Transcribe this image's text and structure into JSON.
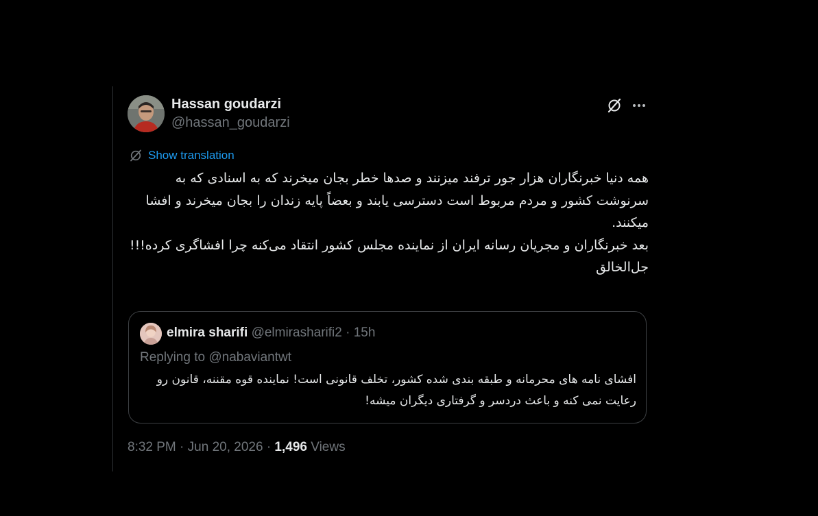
{
  "author": {
    "display_name": "Hassan goudarzi",
    "handle": "@hassan_goudarzi"
  },
  "actions": {
    "grok_icon": "grok-slash-icon",
    "more_icon": "more-horizontal-icon"
  },
  "translation": {
    "label": "Show translation",
    "icon": "translate-icon"
  },
  "tweet": {
    "paragraphs": [
      "همه دنیا خبرنگاران هزار جور ترفند میزنند و صدها خطر بجان میخرند که به اسنادی که به سرنوشت کشور و مردم مربوط است دسترسی یابند و بعضاً پایه زندان را بجان میخرند و افشا میکنند.",
      "بعد خبرنگاران و مجریان رسانه ایران از نماینده مجلس کشور انتقاد می‌کنه چرا افشاگری کرده!!!",
      "جل‌الخالق"
    ]
  },
  "quote": {
    "name": "elmira sharifi",
    "handle": "@elmirasharifi2",
    "separator": "·",
    "time": "15h",
    "replying_to": "Replying to @nabaviantwt",
    "text": "افشای نامه های محرمانه و طبقه بندی شده کشور، تخلف قانونی است! نماینده قوه مقننه، قانون رو رعایت نمی کنه و باعث دردسر و گرفتاری دیگران میشه!"
  },
  "footer": {
    "time": "8:32 PM",
    "separator": "·",
    "date": "Jun 20, 2026",
    "views_count": "1,496",
    "views_label": "Views"
  },
  "colors": {
    "background": "#000000",
    "text": "#e7e9ea",
    "muted": "#71767b",
    "link": "#1d9bf0",
    "border": "#3d4043"
  }
}
